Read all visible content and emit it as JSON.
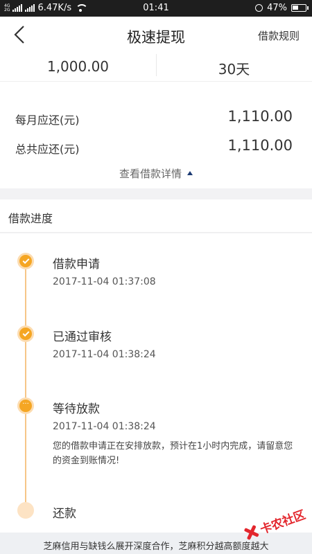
{
  "status_bar": {
    "signal_label_top": "4G",
    "signal_label_bottom": "2G",
    "speed": "6.47K/s",
    "time": "01:41",
    "battery": "47%",
    "battery_level": 0.47
  },
  "nav": {
    "title": "极速提现",
    "rules_label": "借款规则"
  },
  "summary": {
    "amount": "1,000.00",
    "term": "30天",
    "monthly_label": "每月应还(元)",
    "monthly_value": "1,110.00",
    "total_label": "总共应还(元)",
    "total_value": "1,110.00",
    "details_label": "查看借款详情"
  },
  "progress": {
    "title": "借款进度",
    "steps": [
      {
        "title": "借款申请",
        "time": "2017-11-04 01:37:08",
        "state": "done"
      },
      {
        "title": "已通过审核",
        "time": "2017-11-04 01:38:24",
        "state": "done"
      },
      {
        "title": "等待放款",
        "time": "2017-11-04 01:38:24",
        "state": "current",
        "note": "您的借款申请正在安排放款，预计在1小时内完成，请留意您的资金到账情况!"
      },
      {
        "title": "还款",
        "state": "pending"
      }
    ]
  },
  "banner": {
    "text": "芝麻信用与缺钱么展开深度合作，芝麻积分越高额度越大"
  },
  "watermark": {
    "text": "卡农社区"
  },
  "colors": {
    "accent": "#f5a623",
    "timeline": "#f6c687",
    "watermark": "#e3262d"
  }
}
